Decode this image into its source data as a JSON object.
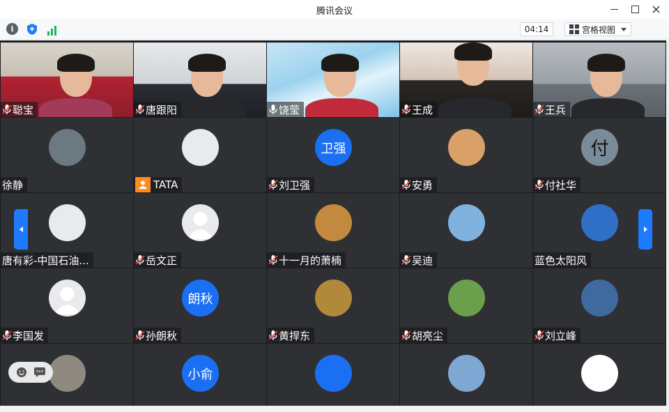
{
  "window": {
    "title": "腾讯会议"
  },
  "toolbar": {
    "timer": "04:14",
    "view_label": "宫格视图"
  },
  "colors": {
    "accent": "#1e7bff",
    "active_border": "#2bb673",
    "signal": "#22b35e",
    "avatar_blue": "#1b6ff2"
  },
  "participants": [
    {
      "name": "聪宝",
      "mic": "muted",
      "type": "video"
    },
    {
      "name": "唐跟阳",
      "mic": "muted",
      "type": "video"
    },
    {
      "name": "饶莹",
      "mic": "on",
      "type": "video",
      "active": true
    },
    {
      "name": "王成",
      "mic": "muted",
      "type": "video"
    },
    {
      "name": "王兵",
      "mic": "muted",
      "type": "video"
    },
    {
      "name": "徐静",
      "mic": "none",
      "type": "photo"
    },
    {
      "name": "TATA",
      "mic": "person",
      "type": "photo"
    },
    {
      "name": "刘卫强",
      "mic": "muted",
      "type": "initials",
      "initials": "卫强"
    },
    {
      "name": "安勇",
      "mic": "muted",
      "type": "photo"
    },
    {
      "name": "付社华",
      "mic": "muted",
      "type": "photo",
      "glyph": "付"
    },
    {
      "name": "唐有彩-中国石油...",
      "mic": "none",
      "type": "photo"
    },
    {
      "name": "岳文正",
      "mic": "muted",
      "type": "default"
    },
    {
      "name": "十一月的萧楠",
      "mic": "muted",
      "type": "photo"
    },
    {
      "name": "吴迪",
      "mic": "muted",
      "type": "photo"
    },
    {
      "name": "蓝色太阳风",
      "mic": "none",
      "type": "photo"
    },
    {
      "name": "李国发",
      "mic": "muted",
      "type": "default"
    },
    {
      "name": "孙朗秋",
      "mic": "muted",
      "type": "initials",
      "initials": "朗秋"
    },
    {
      "name": "黄捍东",
      "mic": "muted",
      "type": "photo"
    },
    {
      "name": "胡亮尘",
      "mic": "muted",
      "type": "photo"
    },
    {
      "name": "刘立峰",
      "mic": "muted",
      "type": "photo"
    },
    {
      "name": "",
      "mic": "none",
      "type": "photo"
    },
    {
      "name": "",
      "mic": "none",
      "type": "initials",
      "initials": "小俞"
    },
    {
      "name": "",
      "mic": "none",
      "type": "photo"
    },
    {
      "name": "",
      "mic": "none",
      "type": "photo"
    },
    {
      "name": "",
      "mic": "none",
      "type": "photo"
    }
  ]
}
